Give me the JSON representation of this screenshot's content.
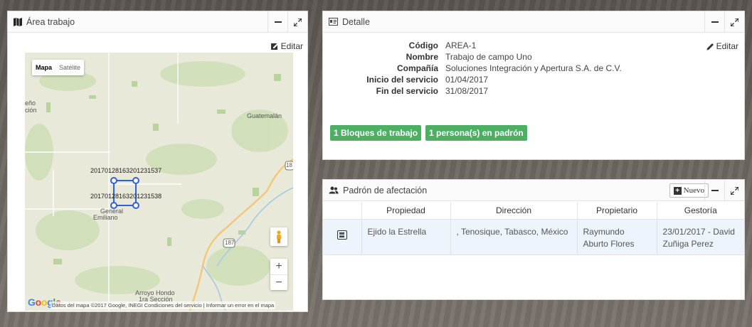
{
  "map_panel": {
    "title": "Área trabajo",
    "edit_label": "Editar",
    "map_type": {
      "map": "Mapa",
      "satellite": "Satélite"
    },
    "places": {
      "guatemalan": "Guatemalán",
      "left_cut_1": "eño",
      "left_cut_2": "ción",
      "general": "General",
      "emiliano": "Emiliano",
      "arroyo": "Arroyo Hondo",
      "seccion": "1ra Sección",
      "road_187": "187",
      "road_186": "18"
    },
    "point_labels": {
      "top": "20170128163201231537",
      "bottom": "20170128163201231538"
    },
    "zoom_in": "+",
    "zoom_out": "−",
    "google": "Google",
    "footer": "Datos del mapa ©2017 Google, INEGI   Condiciones del servicio  |  Informar un error en el mapa"
  },
  "detail_panel": {
    "title": "Detalle",
    "edit_label": "Editar",
    "fields": [
      {
        "key": "Código",
        "value": "AREA-1"
      },
      {
        "key": "Nombre",
        "value": "Trabajo de campo Uno"
      },
      {
        "key": "Compañía",
        "value": "Soluciones Integración y Apertura S.A. de C.V."
      },
      {
        "key": "Inicio del servicio",
        "value": "01/04/2017"
      },
      {
        "key": "Fin del servicio",
        "value": "31/08/2017"
      }
    ],
    "badges": [
      "1 Bloques de trabajo",
      "1 persona(s) en padrón"
    ]
  },
  "padron_panel": {
    "title": "Padrón de afectación",
    "new_label": "Nuevo",
    "columns": [
      "",
      "Propiedad",
      "Dirección",
      "Propietario",
      "Gestoría"
    ],
    "rows": [
      {
        "propiedad": "Ejido la Estrella",
        "direccion": ", Tenosique, Tabasco, México",
        "propietario": "Raymundo Aburto Flores",
        "gestoria": "23/01/2017 - David Zuñiga Perez"
      }
    ]
  }
}
